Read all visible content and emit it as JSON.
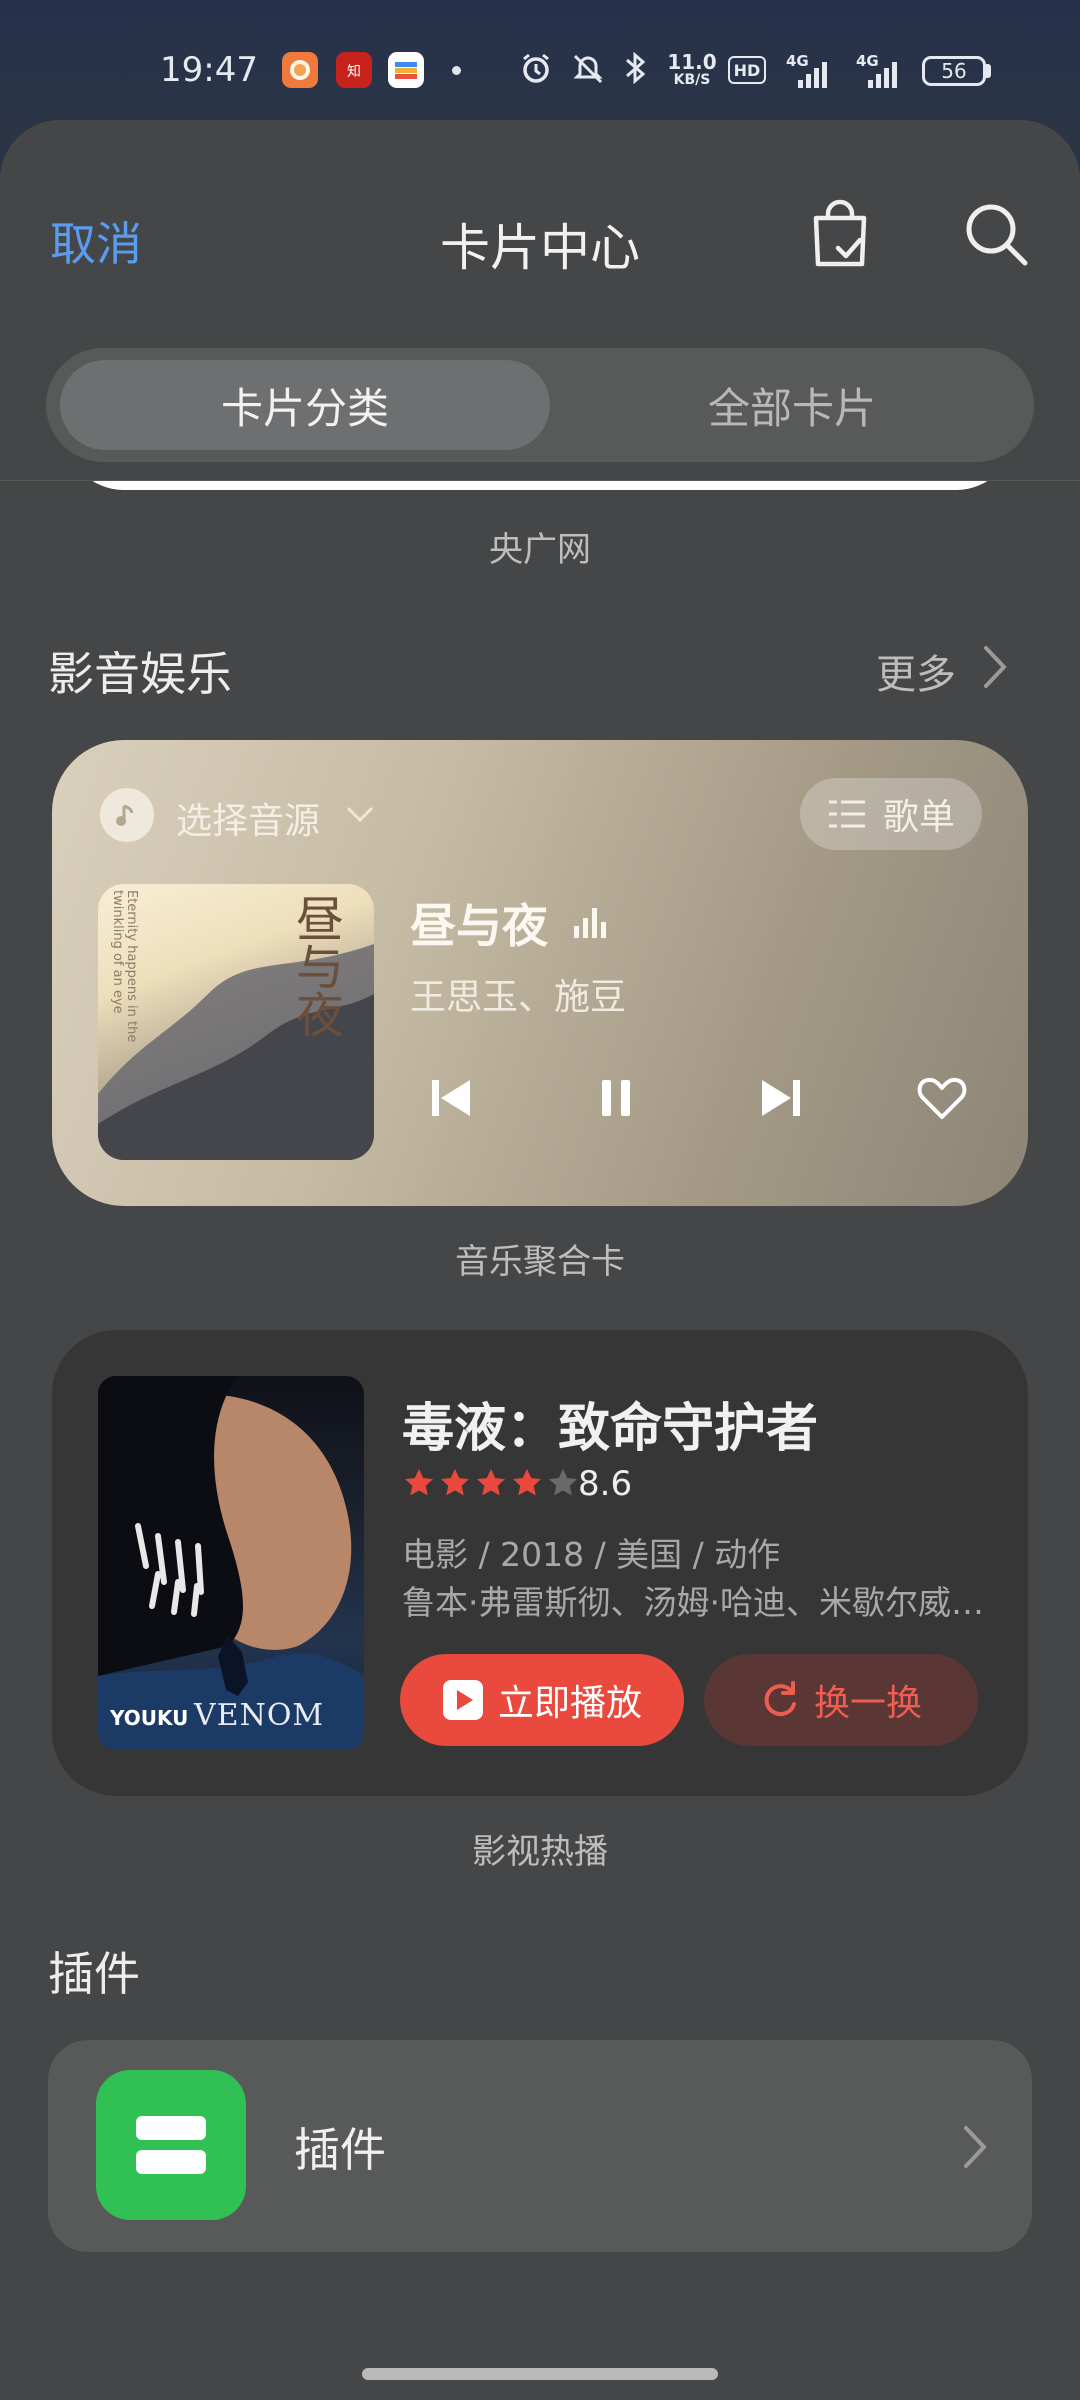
{
  "status_bar": {
    "time": "19:47",
    "net_speed_top": "11.0",
    "net_speed_bottom": "KB/S",
    "hd_label": "HD",
    "signal1": "4G",
    "signal2": "4G",
    "battery": "56",
    "app_icons": [
      "orange-app-icon",
      "zhihu-app-icon",
      "wallet-app-icon"
    ],
    "status_icons": [
      "alarm-icon",
      "mute-icon",
      "bluetooth-icon"
    ]
  },
  "header": {
    "cancel_label": "取消",
    "title": "卡片中心"
  },
  "segment": {
    "active": "卡片分类",
    "inactive": "全部卡片"
  },
  "prev_card": {
    "label": "央广网"
  },
  "section_media": {
    "title": "影音娱乐",
    "more": "更多"
  },
  "music_card": {
    "source_label": "选择音源",
    "playlist_label": "歌单",
    "song": "昼与夜",
    "artist": "王思玉、施豆",
    "cover_title": "昼与夜",
    "cover_side_text": "Eternity happens in the twinkling of an eye",
    "label": "音乐聚合卡"
  },
  "movie_card": {
    "title": "毒液：致命守护者",
    "stars": 4,
    "rating": "8.6",
    "meta": "电影 / 2018 / 美国 / 动作",
    "cast": "鲁本·弗雷斯彻、汤姆·哈迪、米歇尔威…",
    "poster_brand": "YOUKU",
    "poster_title": "VENOM",
    "play_label": "立即播放",
    "swap_label": "换一换",
    "label": "影视热播"
  },
  "section_plugin": {
    "title": "插件"
  },
  "plugin_item": {
    "name": "插件"
  },
  "colors": {
    "accent_blue": "#5a9cf0",
    "play_red": "#ea4a3e",
    "plugin_green": "#31c054",
    "star_red": "#e8493c"
  }
}
